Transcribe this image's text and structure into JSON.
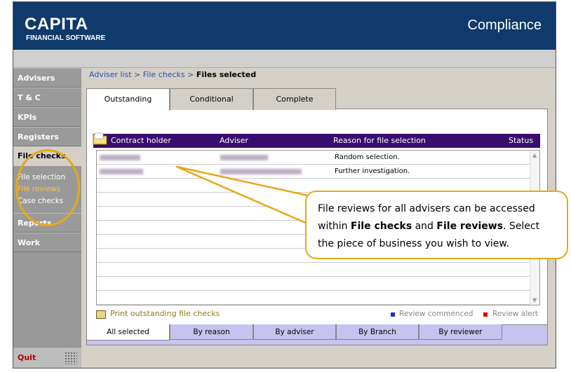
{
  "header": {
    "logo": "CAPITA",
    "logo_sub": "FINANCIAL SOFTWARE",
    "app_title": "Compliance"
  },
  "sidebar": {
    "items": [
      {
        "label": "Advisers"
      },
      {
        "label": "T & C"
      },
      {
        "label": "KPIs"
      },
      {
        "label": "Registers"
      },
      {
        "label": "File checks"
      },
      {
        "label": "Reports"
      },
      {
        "label": "Work"
      }
    ],
    "subitems": [
      {
        "label": "File selection"
      },
      {
        "label": "File reviews"
      },
      {
        "label": "Case checks"
      }
    ],
    "quit": "Quit"
  },
  "breadcrumb": {
    "link1": "Adviser list",
    "sep": " > ",
    "link2": "File checks",
    "current": "Files selected"
  },
  "tabs": [
    "Outstanding",
    "Conditional",
    "Complete"
  ],
  "table": {
    "columns": [
      "Contract holder",
      "Adviser",
      "Reason for file selection",
      "Status"
    ],
    "rows": [
      {
        "reason": "Random selection."
      },
      {
        "reason": "Further investigation."
      }
    ]
  },
  "footer": {
    "print": "Print outstanding file checks",
    "legend_commenced": "Review commenced",
    "legend_alert": "Review alert",
    "colors": {
      "commenced": "#1a2fd8",
      "alert": "#e00000"
    }
  },
  "bottom_tabs": [
    "All selected",
    "By reason",
    "By adviser",
    "By Branch",
    "By reviewer"
  ],
  "callout": {
    "text1": "File reviews for all advisers can be accessed within ",
    "bold1": "File checks",
    "text2": " and ",
    "bold2": "File reviews",
    "text3": ". Select the piece of business you wish to view."
  }
}
